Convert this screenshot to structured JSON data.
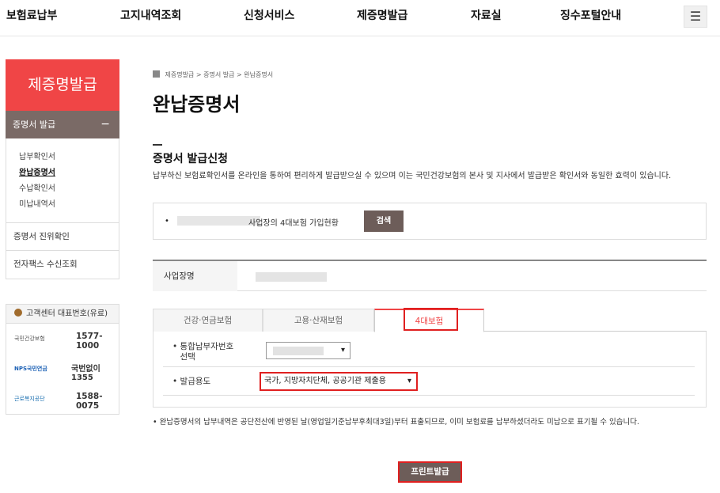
{
  "nav": {
    "items": [
      "보험료납부",
      "고지내역조회",
      "신청서비스",
      "제증명발급",
      "자료실",
      "징수포털안내"
    ],
    "menu_icon": "hamburger-icon"
  },
  "sidebar": {
    "header": "제증명발급",
    "category": "증명서 발급",
    "category_toggle": "−",
    "sub_items": [
      "납부확인서",
      "완납증명서",
      "수납확인서",
      "미납내역서"
    ],
    "links": [
      "증명서 진위확인",
      "전자팩스 수신조회"
    ],
    "customer_center": {
      "title": "고객센터 대표번호(유료)",
      "rows": [
        {
          "org": "국민건강보험",
          "number": "1577-1000"
        },
        {
          "org": "NPS국민연금",
          "number": "국번없이1355"
        },
        {
          "org": "근로복지공단",
          "number": "1588-0075"
        }
      ]
    }
  },
  "breadcrumb": [
    "제증명발급 >",
    "증명서 발급 >",
    "완납증명서"
  ],
  "page_title": "완납증명서",
  "section": {
    "title": "증명서 발급신청",
    "description": "납부하신 보험료확인서를 온라인을 통하여 편리하게 발급받으실 수 있으며 이는 국민건강보험의 본사 및 지사에서 발급받은 확인서와 동일한 효력이 있습니다."
  },
  "search": {
    "label": "사업장의 4대보험 가입현황",
    "button": "검색"
  },
  "business": {
    "label": "사업장명"
  },
  "tabs": [
    "건강·연금보험",
    "고용·산재보험",
    "4대보험"
  ],
  "form": {
    "payer_label": "통합납부자번호선택",
    "purpose_label": "발급용도",
    "purpose_value": "국가, 지방자치단체, 공공기관 제출용"
  },
  "notice": "완납증명서의 납부내역은 공단전산에 반영된 날(영업일기준납부후최대3일)부터 표출되므로, 이미 보험료를 납부하셨더라도 미납으로 표기될 수 있습니다.",
  "print_button": "프린트발급"
}
